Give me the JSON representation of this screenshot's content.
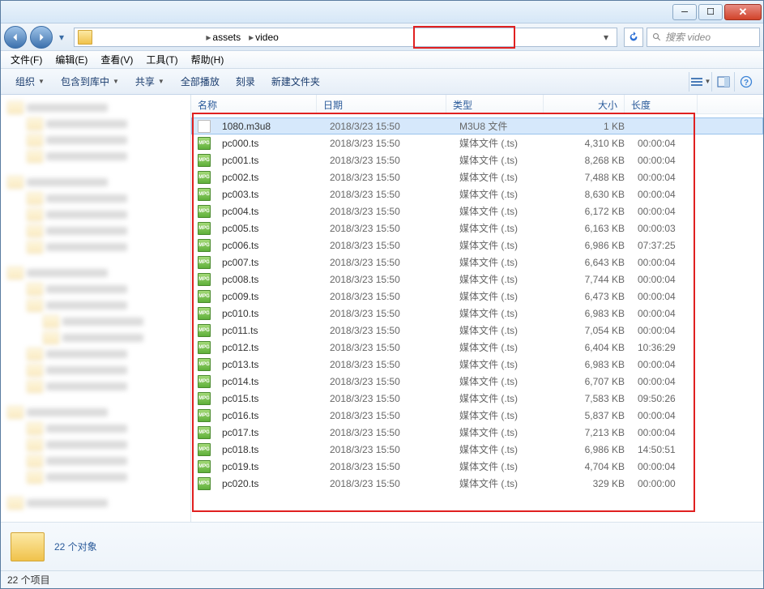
{
  "breadcrumb": {
    "seg1": "assets",
    "seg2": "video"
  },
  "search": {
    "placeholder": "搜索 video"
  },
  "menubar": [
    {
      "label": "文件(F)"
    },
    {
      "label": "编辑(E)"
    },
    {
      "label": "查看(V)"
    },
    {
      "label": "工具(T)"
    },
    {
      "label": "帮助(H)"
    }
  ],
  "toolbar": {
    "organize": "组织",
    "include": "包含到库中",
    "share": "共享",
    "playall": "全部播放",
    "burn": "刻录",
    "newfolder": "新建文件夹"
  },
  "columns": {
    "name": "名称",
    "date": "日期",
    "type": "类型",
    "size": "大小",
    "length": "长度"
  },
  "files": [
    {
      "icon": "doc",
      "name": "1080.m3u8",
      "date": "2018/3/23 15:50",
      "type": "M3U8 文件",
      "size": "1 KB",
      "length": "",
      "selected": true
    },
    {
      "icon": "mpg",
      "name": "pc000.ts",
      "date": "2018/3/23 15:50",
      "type": "媒体文件 (.ts)",
      "size": "4,310 KB",
      "length": "00:00:04"
    },
    {
      "icon": "mpg",
      "name": "pc001.ts",
      "date": "2018/3/23 15:50",
      "type": "媒体文件 (.ts)",
      "size": "8,268 KB",
      "length": "00:00:04"
    },
    {
      "icon": "mpg",
      "name": "pc002.ts",
      "date": "2018/3/23 15:50",
      "type": "媒体文件 (.ts)",
      "size": "7,488 KB",
      "length": "00:00:04"
    },
    {
      "icon": "mpg",
      "name": "pc003.ts",
      "date": "2018/3/23 15:50",
      "type": "媒体文件 (.ts)",
      "size": "8,630 KB",
      "length": "00:00:04"
    },
    {
      "icon": "mpg",
      "name": "pc004.ts",
      "date": "2018/3/23 15:50",
      "type": "媒体文件 (.ts)",
      "size": "6,172 KB",
      "length": "00:00:04"
    },
    {
      "icon": "mpg",
      "name": "pc005.ts",
      "date": "2018/3/23 15:50",
      "type": "媒体文件 (.ts)",
      "size": "6,163 KB",
      "length": "00:00:03"
    },
    {
      "icon": "mpg",
      "name": "pc006.ts",
      "date": "2018/3/23 15:50",
      "type": "媒体文件 (.ts)",
      "size": "6,986 KB",
      "length": "07:37:25"
    },
    {
      "icon": "mpg",
      "name": "pc007.ts",
      "date": "2018/3/23 15:50",
      "type": "媒体文件 (.ts)",
      "size": "6,643 KB",
      "length": "00:00:04"
    },
    {
      "icon": "mpg",
      "name": "pc008.ts",
      "date": "2018/3/23 15:50",
      "type": "媒体文件 (.ts)",
      "size": "7,744 KB",
      "length": "00:00:04"
    },
    {
      "icon": "mpg",
      "name": "pc009.ts",
      "date": "2018/3/23 15:50",
      "type": "媒体文件 (.ts)",
      "size": "6,473 KB",
      "length": "00:00:04"
    },
    {
      "icon": "mpg",
      "name": "pc010.ts",
      "date": "2018/3/23 15:50",
      "type": "媒体文件 (.ts)",
      "size": "6,983 KB",
      "length": "00:00:04"
    },
    {
      "icon": "mpg",
      "name": "pc011.ts",
      "date": "2018/3/23 15:50",
      "type": "媒体文件 (.ts)",
      "size": "7,054 KB",
      "length": "00:00:04"
    },
    {
      "icon": "mpg",
      "name": "pc012.ts",
      "date": "2018/3/23 15:50",
      "type": "媒体文件 (.ts)",
      "size": "6,404 KB",
      "length": "10:36:29"
    },
    {
      "icon": "mpg",
      "name": "pc013.ts",
      "date": "2018/3/23 15:50",
      "type": "媒体文件 (.ts)",
      "size": "6,983 KB",
      "length": "00:00:04"
    },
    {
      "icon": "mpg",
      "name": "pc014.ts",
      "date": "2018/3/23 15:50",
      "type": "媒体文件 (.ts)",
      "size": "6,707 KB",
      "length": "00:00:04"
    },
    {
      "icon": "mpg",
      "name": "pc015.ts",
      "date": "2018/3/23 15:50",
      "type": "媒体文件 (.ts)",
      "size": "7,583 KB",
      "length": "09:50:26"
    },
    {
      "icon": "mpg",
      "name": "pc016.ts",
      "date": "2018/3/23 15:50",
      "type": "媒体文件 (.ts)",
      "size": "5,837 KB",
      "length": "00:00:04"
    },
    {
      "icon": "mpg",
      "name": "pc017.ts",
      "date": "2018/3/23 15:50",
      "type": "媒体文件 (.ts)",
      "size": "7,213 KB",
      "length": "00:00:04"
    },
    {
      "icon": "mpg",
      "name": "pc018.ts",
      "date": "2018/3/23 15:50",
      "type": "媒体文件 (.ts)",
      "size": "6,986 KB",
      "length": "14:50:51"
    },
    {
      "icon": "mpg",
      "name": "pc019.ts",
      "date": "2018/3/23 15:50",
      "type": "媒体文件 (.ts)",
      "size": "4,704 KB",
      "length": "00:00:04"
    },
    {
      "icon": "mpg",
      "name": "pc020.ts",
      "date": "2018/3/23 15:50",
      "type": "媒体文件 (.ts)",
      "size": "329 KB",
      "length": "00:00:00"
    }
  ],
  "details": {
    "text": "22 个对象"
  },
  "statusbar": {
    "text": "22 个项目"
  }
}
